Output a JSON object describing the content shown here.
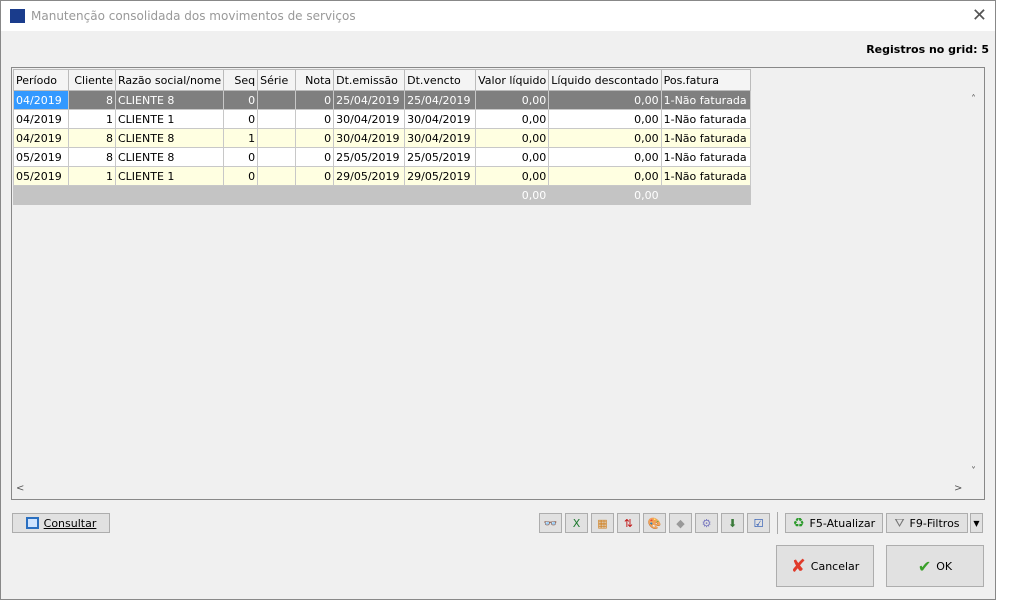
{
  "window": {
    "title": "Manutenção consolidada dos movimentos de serviços"
  },
  "records_label": "Registros no grid: 5",
  "grid": {
    "columns": [
      "Período",
      "Cliente",
      "Razão social/nome",
      "Seq",
      "Série",
      "Nota",
      "Dt.emissão",
      "Dt.vencto",
      "Valor líquido",
      "Líquido descontado",
      "Pos.fatura"
    ],
    "rows": [
      [
        "04/2019",
        "8",
        "CLIENTE 8",
        "0",
        "",
        "0",
        "25/04/2019",
        "25/04/2019",
        "0,00",
        "0,00",
        "1-Não faturada"
      ],
      [
        "04/2019",
        "1",
        "CLIENTE 1",
        "0",
        "",
        "0",
        "30/04/2019",
        "30/04/2019",
        "0,00",
        "0,00",
        "1-Não faturada"
      ],
      [
        "04/2019",
        "8",
        "CLIENTE 8",
        "1",
        "",
        "0",
        "30/04/2019",
        "30/04/2019",
        "0,00",
        "0,00",
        "1-Não faturada"
      ],
      [
        "05/2019",
        "8",
        "CLIENTE 8",
        "0",
        "",
        "0",
        "25/05/2019",
        "25/05/2019",
        "0,00",
        "0,00",
        "1-Não faturada"
      ],
      [
        "05/2019",
        "1",
        "CLIENTE 1",
        "0",
        "",
        "0",
        "29/05/2019",
        "29/05/2019",
        "0,00",
        "0,00",
        "1-Não faturada"
      ]
    ],
    "totals": {
      "valor_liquido": "0,00",
      "liquido_descontado": "0,00"
    },
    "selected_row": 0
  },
  "buttons": {
    "consultar": "Consultar",
    "atualizar": "F5-Atualizar",
    "filtros": "F9-Filtros",
    "cancelar": "Cancelar",
    "ok": "OK"
  },
  "toolbar_icons": [
    "binoculars-icon",
    "excel-icon",
    "grid-layout-icon",
    "sort-icon",
    "palette-icon",
    "eraser-icon",
    "gear-icon",
    "download-icon",
    "checklist-icon"
  ]
}
